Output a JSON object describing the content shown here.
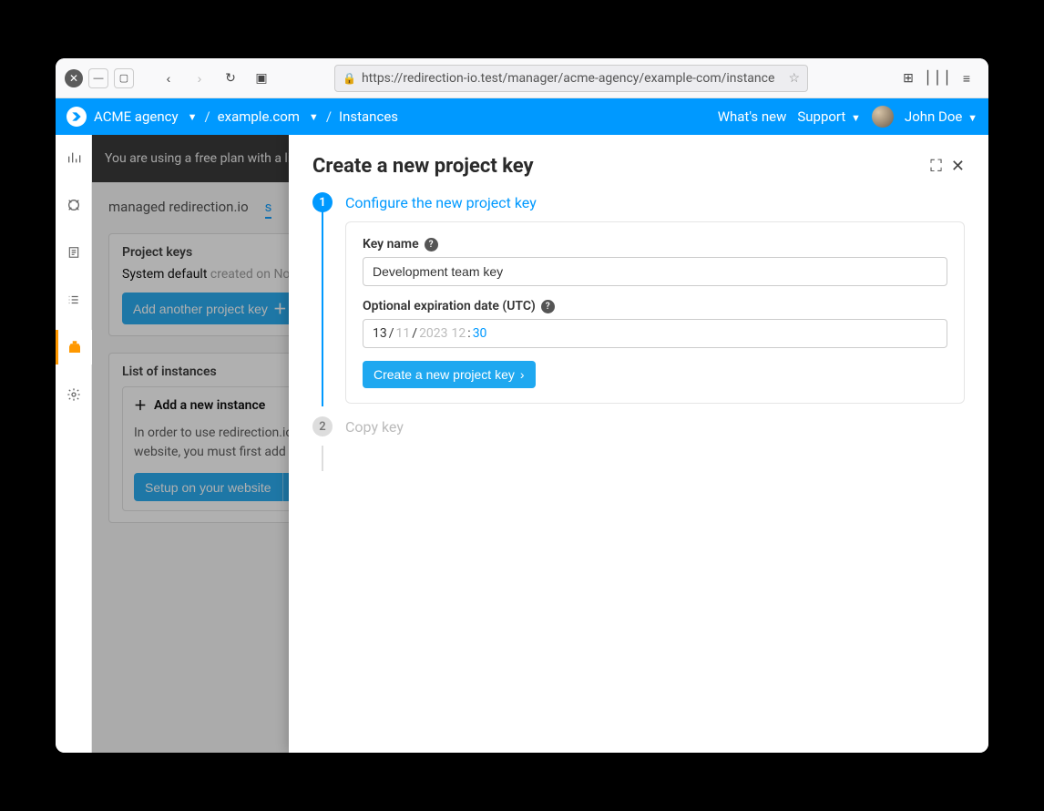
{
  "browser": {
    "url": "https://redirection-io.test/manager/acme-agency/example-com/instance"
  },
  "header": {
    "org": "ACME agency",
    "project": "example.com",
    "page": "Instances",
    "whats_new": "What's new",
    "support": "Support",
    "user": "John Doe"
  },
  "banner": {
    "text": "You are using a free plan with a lim"
  },
  "tabs": {
    "managed": "managed redirection.io",
    "self_partial": "s"
  },
  "project_keys": {
    "title": "Project keys",
    "row_name": "System default",
    "row_created": "created on Nove",
    "add_btn": "Add another project key"
  },
  "instances": {
    "title": "List of instances",
    "add_label": "Add a new instance",
    "text1": "In order to use redirection.io o",
    "text2": "website, you must first add an",
    "setup_btn": "Setup on your website"
  },
  "panel": {
    "title": "Create a new project key",
    "step1": {
      "num": "1",
      "label": "Configure the new project key",
      "key_name_label": "Key name",
      "key_name_value": "Development team key",
      "expiry_label": "Optional expiration date (UTC)",
      "date_dd": "13",
      "date_mm": "11",
      "date_yyyy": "2023",
      "date_hh": "12",
      "date_min": "30",
      "create_btn": "Create a new project key"
    },
    "step2": {
      "num": "2",
      "label": "Copy key"
    }
  }
}
